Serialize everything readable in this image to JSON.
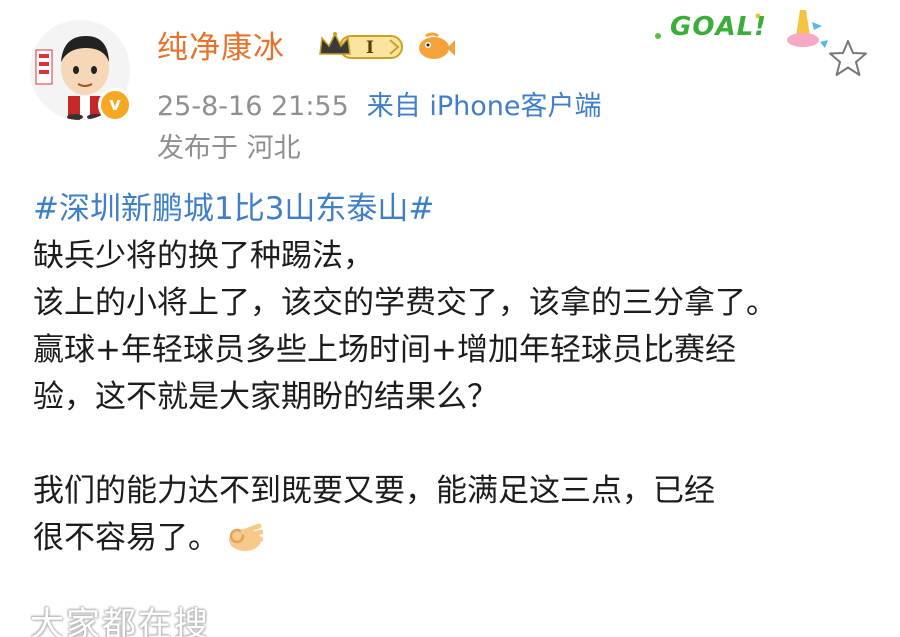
{
  "post": {
    "author": "纯净康冰",
    "level_badge": "I",
    "timestamp": "25-8-16 21:55",
    "source": "来自 iPhone客户端",
    "location": "发布于 河北",
    "hashtag": "#深圳新鹏城1比3山东泰山#",
    "lines": [
      "缺兵少将的换了种踢法，",
      "该上的小将上了，该交的学费交了，该拿的三分拿了。",
      "赢球+年轻球员多些上场时间+增加年轻球员比赛经",
      "验，这不就是大家期盼的结果么？",
      "",
      "我们的能力达不到既要又要，能满足这三点，已经",
      "很不容易了。"
    ],
    "end_emoji": "ok-hand-emoji"
  },
  "decor": {
    "goal_text": "GOAL!",
    "watermark": "大家都在搜"
  },
  "icons": {
    "verified": "verified-badge-icon",
    "crown": "crown-level-icon",
    "fish": "fish-badge-icon",
    "star": "favorite-star-icon"
  },
  "colors": {
    "username": "#e8712b",
    "link": "#3f7ec8",
    "meta": "#8f8f8f",
    "verified": "#f7a823",
    "goal": "#3aae38"
  }
}
